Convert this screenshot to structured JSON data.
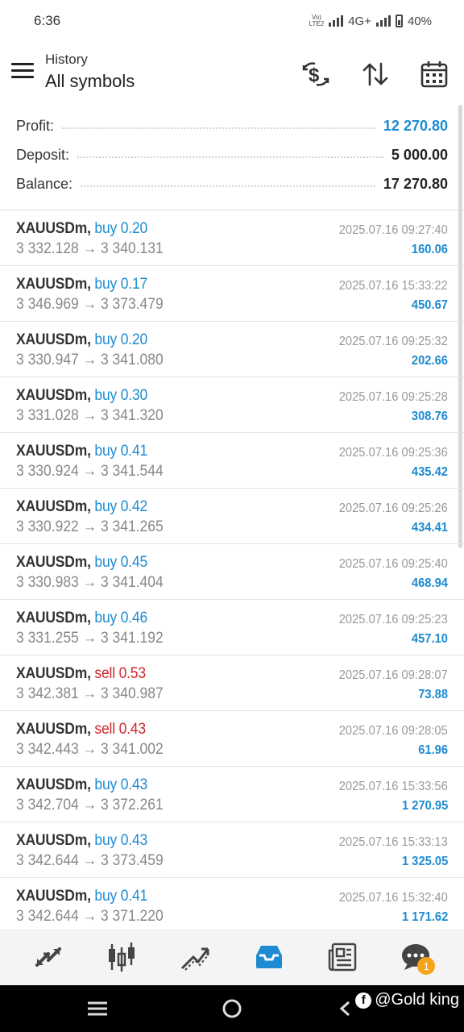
{
  "status_bar": {
    "time": "6:36",
    "network_small": "VoLTE2",
    "network_type": "4G+",
    "battery": "40%"
  },
  "header": {
    "title": "History",
    "subtitle": "All symbols"
  },
  "summary": {
    "profit_label": "Profit:",
    "profit_value": "12 270.80",
    "deposit_label": "Deposit:",
    "deposit_value": "5 000.00",
    "balance_label": "Balance:",
    "balance_value": "17 270.80"
  },
  "trades": [
    {
      "symbol": "XAUUSDm,",
      "side": "buy 0.20",
      "type": "buy",
      "prices": "3 332.128 → 3 340.131",
      "time": "2025.07.16 09:27:40",
      "profit": "160.06"
    },
    {
      "symbol": "XAUUSDm,",
      "side": "buy 0.17",
      "type": "buy",
      "prices": "3 346.969 → 3 373.479",
      "time": "2025.07.16 15:33:22",
      "profit": "450.67"
    },
    {
      "symbol": "XAUUSDm,",
      "side": "buy 0.20",
      "type": "buy",
      "prices": "3 330.947 → 3 341.080",
      "time": "2025.07.16 09:25:32",
      "profit": "202.66"
    },
    {
      "symbol": "XAUUSDm,",
      "side": "buy 0.30",
      "type": "buy",
      "prices": "3 331.028 → 3 341.320",
      "time": "2025.07.16 09:25:28",
      "profit": "308.76"
    },
    {
      "symbol": "XAUUSDm,",
      "side": "buy 0.41",
      "type": "buy",
      "prices": "3 330.924 → 3 341.544",
      "time": "2025.07.16 09:25:36",
      "profit": "435.42"
    },
    {
      "symbol": "XAUUSDm,",
      "side": "buy 0.42",
      "type": "buy",
      "prices": "3 330.922 → 3 341.265",
      "time": "2025.07.16 09:25:26",
      "profit": "434.41"
    },
    {
      "symbol": "XAUUSDm,",
      "side": "buy 0.45",
      "type": "buy",
      "prices": "3 330.983 → 3 341.404",
      "time": "2025.07.16 09:25:40",
      "profit": "468.94"
    },
    {
      "symbol": "XAUUSDm,",
      "side": "buy 0.46",
      "type": "buy",
      "prices": "3 331.255 → 3 341.192",
      "time": "2025.07.16 09:25:23",
      "profit": "457.10"
    },
    {
      "symbol": "XAUUSDm,",
      "side": "sell 0.53",
      "type": "sell",
      "prices": "3 342.381 → 3 340.987",
      "time": "2025.07.16 09:28:07",
      "profit": "73.88"
    },
    {
      "symbol": "XAUUSDm,",
      "side": "sell 0.43",
      "type": "sell",
      "prices": "3 342.443 → 3 341.002",
      "time": "2025.07.16 09:28:05",
      "profit": "61.96"
    },
    {
      "symbol": "XAUUSDm,",
      "side": "buy 0.43",
      "type": "buy",
      "prices": "3 342.704 → 3 372.261",
      "time": "2025.07.16 15:33:56",
      "profit": "1 270.95"
    },
    {
      "symbol": "XAUUSDm,",
      "side": "buy 0.43",
      "type": "buy",
      "prices": "3 342.644 → 3 373.459",
      "time": "2025.07.16 15:33:13",
      "profit": "1 325.05"
    },
    {
      "symbol": "XAUUSDm,",
      "side": "buy 0.41",
      "type": "buy",
      "prices": "3 342.644 → 3 371.220",
      "time": "2025.07.16 15:32:40",
      "profit": "1 171.62"
    }
  ],
  "bottom_nav": {
    "items": [
      {
        "icon": "quotes-icon"
      },
      {
        "icon": "chart-icon"
      },
      {
        "icon": "trade-icon"
      },
      {
        "icon": "history-icon"
      },
      {
        "icon": "news-icon"
      },
      {
        "icon": "messages-icon"
      }
    ],
    "messages_badge": "1",
    "active_color": "#1d8bd1"
  },
  "watermark": {
    "text": "@Gold king"
  },
  "colors": {
    "buy": "#1d8bd1",
    "sell": "#d0262e",
    "profit": "#1d8bd1"
  }
}
